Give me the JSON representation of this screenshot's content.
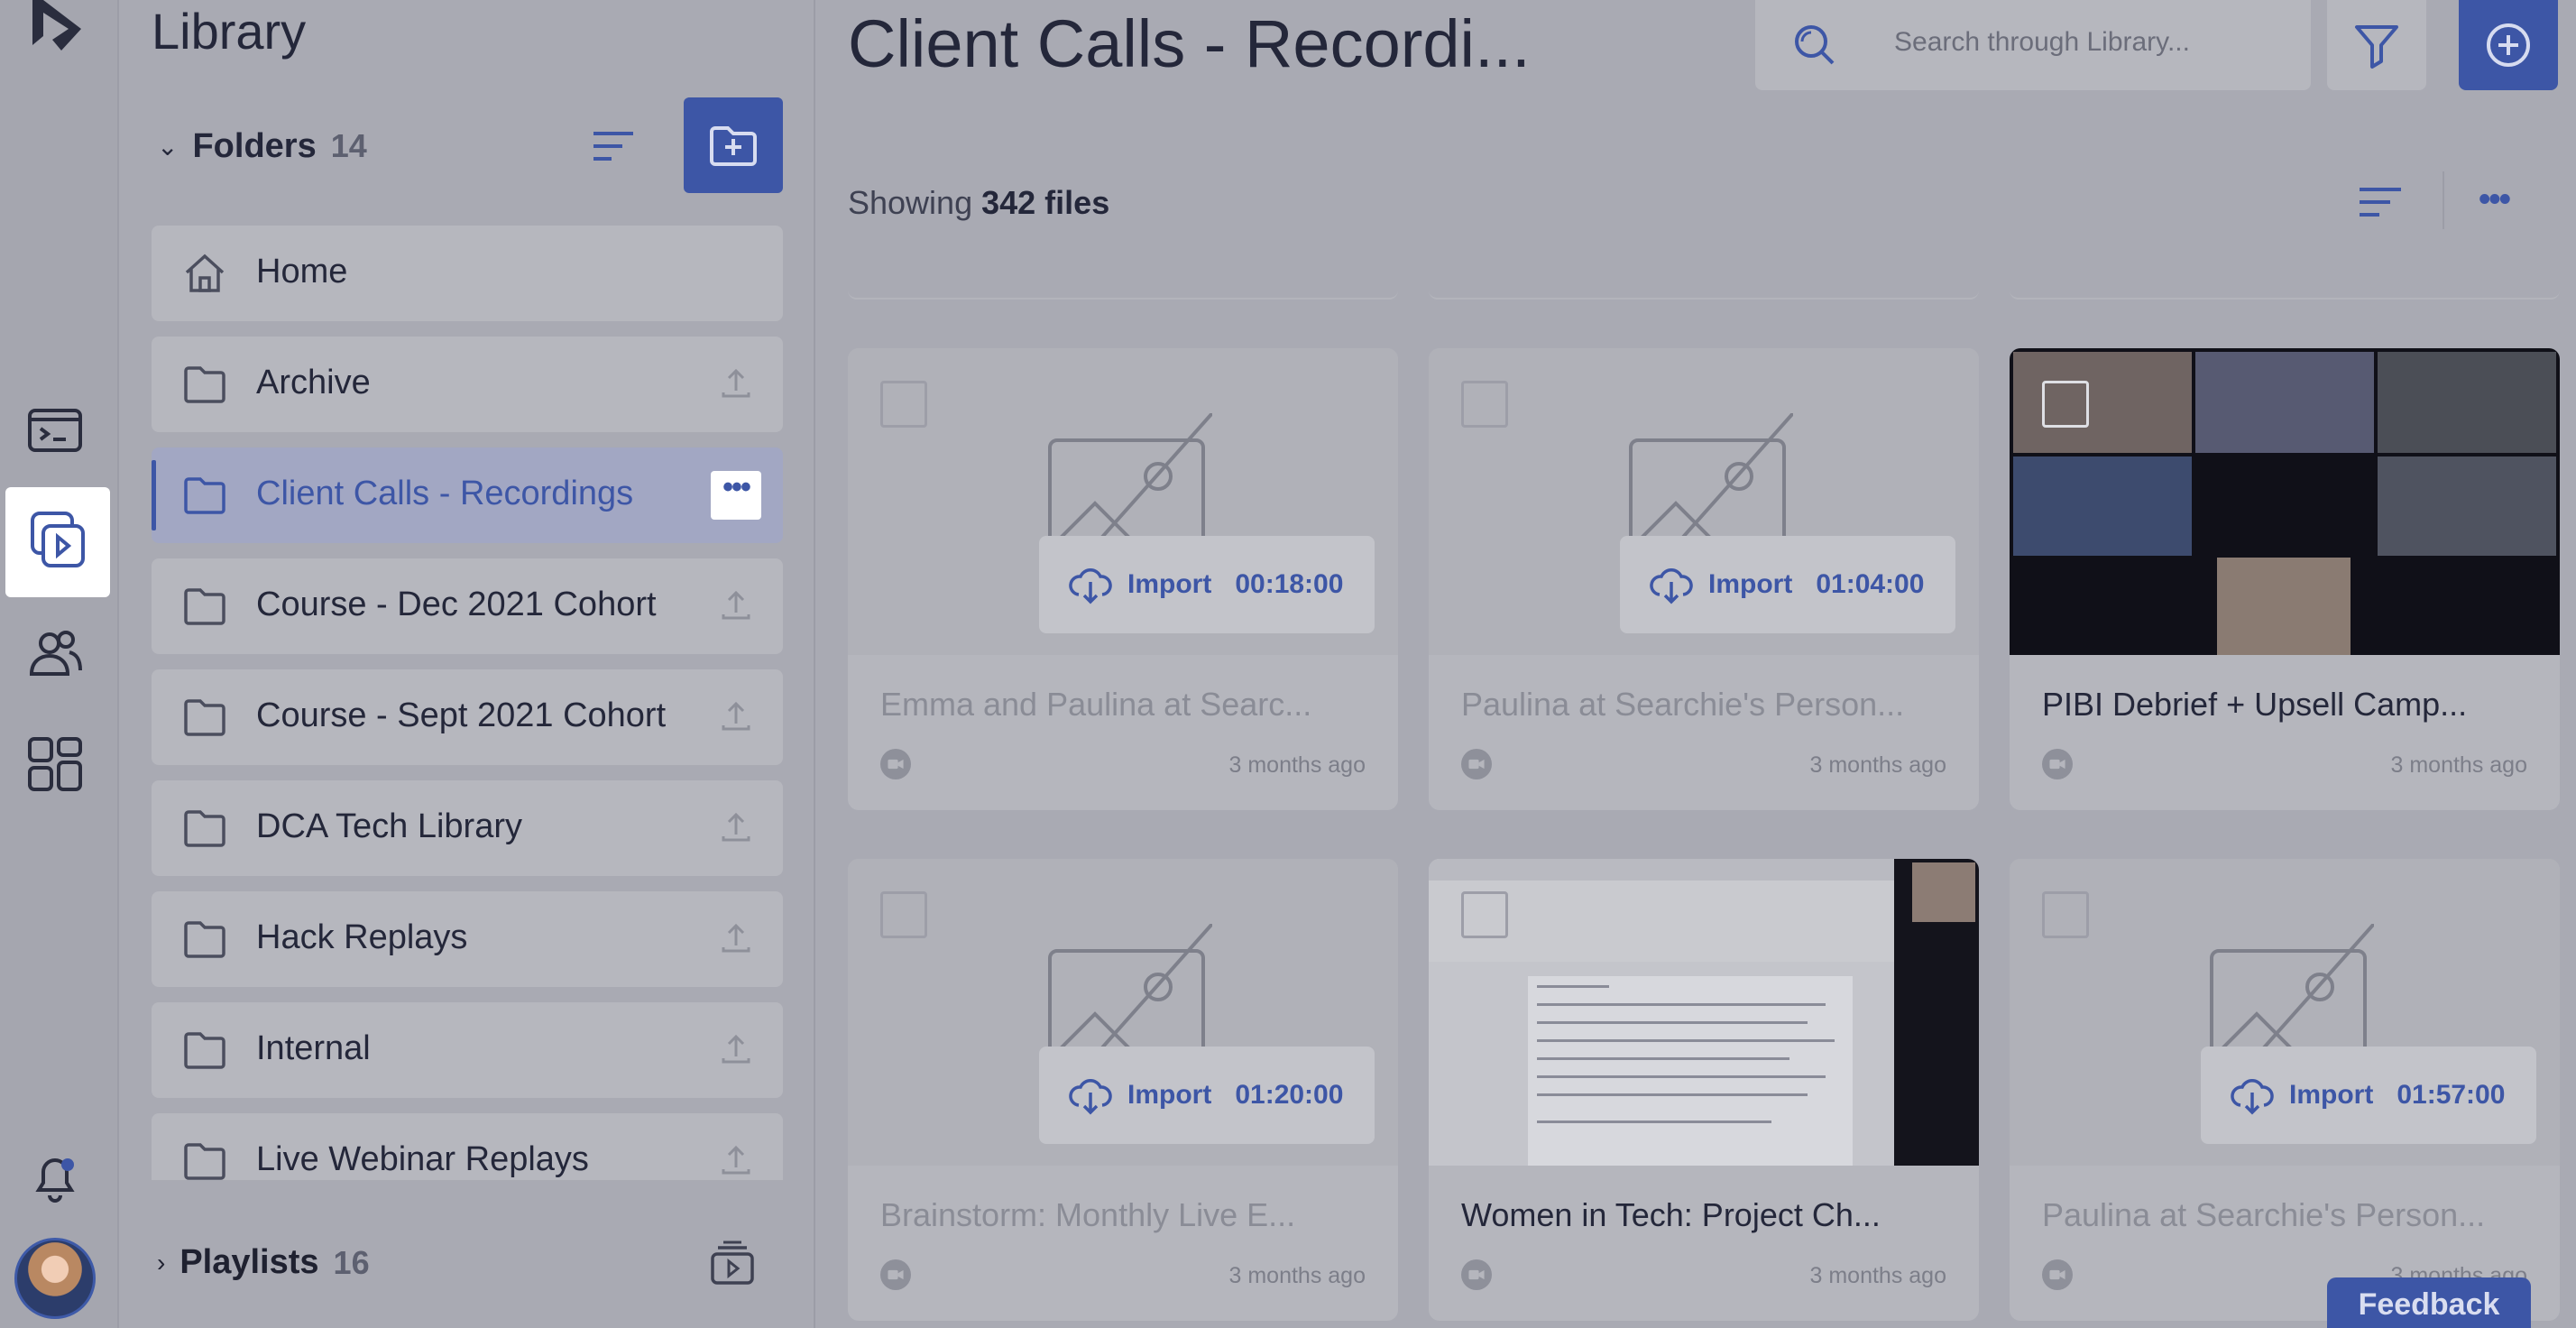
{
  "colors": {
    "accent": "#3d56a6",
    "overlay_bg": "#a9aab3",
    "card_bg": "#b5b6bd"
  },
  "rail": {
    "icons": [
      "logo-icon",
      "terminal-icon",
      "library-icon",
      "people-icon",
      "apps-icon",
      "bell-icon"
    ]
  },
  "sidebar": {
    "title": "Library",
    "folders_label": "Folders",
    "folders_count": "14",
    "folders": [
      {
        "name": "Home"
      },
      {
        "name": "Archive"
      },
      {
        "name": "Client Calls - Recordings"
      },
      {
        "name": "Course - Dec 2021 Cohort"
      },
      {
        "name": "Course - Sept 2021 Cohort"
      },
      {
        "name": "DCA Tech Library"
      },
      {
        "name": "Hack Replays"
      },
      {
        "name": "Internal"
      },
      {
        "name": "Live Webinar Replays"
      }
    ],
    "active_folder_more": "•••",
    "playlists_label": "Playlists",
    "playlists_count": "16"
  },
  "main": {
    "title": "Client Calls - Recordi...",
    "search_placeholder": "Search through Library...",
    "showing_prefix": "Showing",
    "showing_count": "342 files",
    "more_label": "•••",
    "import_label": "Import",
    "cards": [
      {
        "title": "Emma and Paulina at Searc...",
        "ago": "3 months ago",
        "duration": "00:18:00"
      },
      {
        "title": "Paulina at Searchie's Person...",
        "ago": "3 months ago",
        "duration": "01:04:00"
      },
      {
        "title": "PIBI Debrief + Upsell Camp...",
        "ago": "3 months ago"
      },
      {
        "title": "Brainstorm: Monthly Live E...",
        "ago": "3 months ago",
        "duration": "01:20:00"
      },
      {
        "title": "Women in Tech: Project Ch...",
        "ago": "3 months ago"
      },
      {
        "title": "Paulina at Searchie's Person...",
        "ago": "3 months ago",
        "duration": "01:57:00"
      }
    ]
  },
  "feedback_label": "Feedback"
}
